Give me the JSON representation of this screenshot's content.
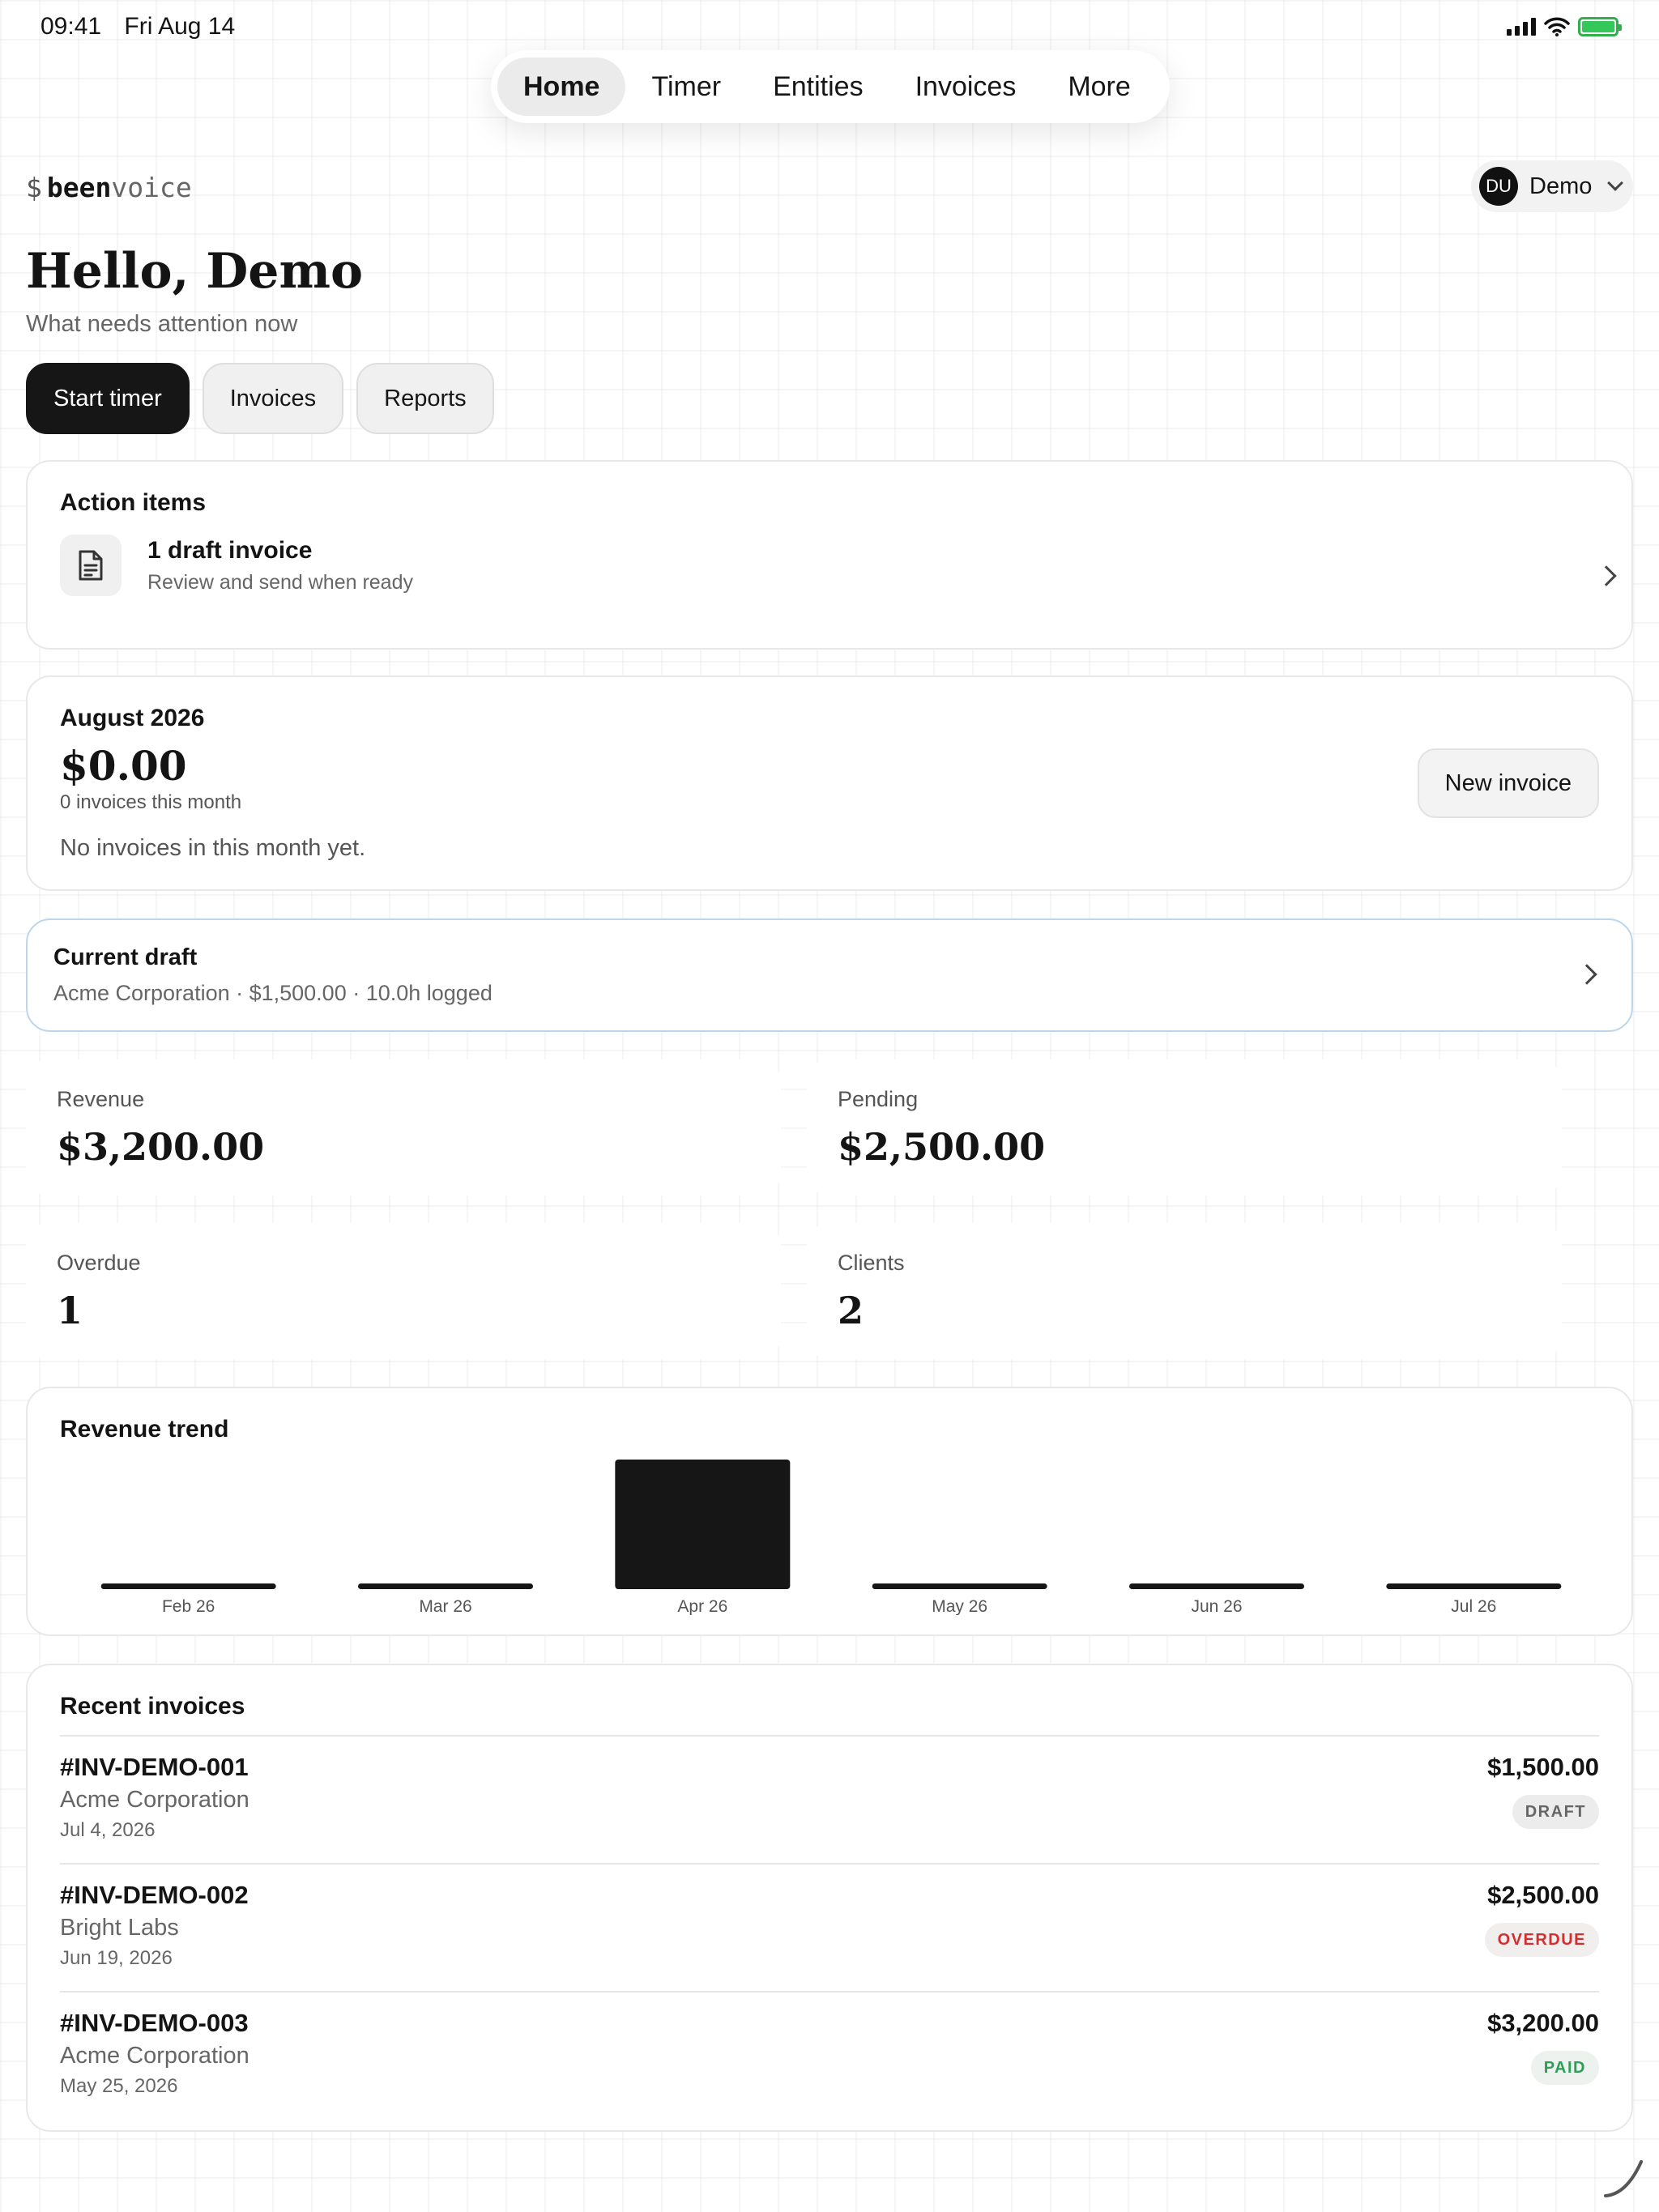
{
  "status_bar": {
    "time": "09:41",
    "date": "Fri Aug 14"
  },
  "nav": {
    "items": [
      {
        "label": "Home",
        "active": true
      },
      {
        "label": "Timer",
        "active": false
      },
      {
        "label": "Entities",
        "active": false
      },
      {
        "label": "Invoices",
        "active": false
      },
      {
        "label": "More",
        "active": false
      }
    ]
  },
  "brand": {
    "symbol": "$",
    "bold": "been",
    "light": "voice"
  },
  "user": {
    "initials": "DU",
    "name": "Demo"
  },
  "greeting": {
    "title": "Hello, Demo",
    "subtitle": "What needs attention now"
  },
  "quick_actions": {
    "start_timer": "Start timer",
    "invoices": "Invoices",
    "reports": "Reports"
  },
  "action_items": {
    "title": "Action items",
    "items": [
      {
        "title": "1 draft invoice",
        "subtitle": "Review and send when ready",
        "icon": "document-icon"
      }
    ]
  },
  "month_summary": {
    "title": "August 2026",
    "amount": "$0.00",
    "count_text": "0 invoices this month",
    "empty_text": "No invoices in this month yet.",
    "new_invoice_label": "New invoice"
  },
  "current_draft": {
    "title": "Current draft",
    "details": "Acme Corporation · $1,500.00 · 10.0h logged"
  },
  "stats": {
    "revenue": {
      "label": "Revenue",
      "value": "$3,200.00"
    },
    "pending": {
      "label": "Pending",
      "value": "$2,500.00"
    },
    "overdue": {
      "label": "Overdue",
      "value": "1"
    },
    "clients": {
      "label": "Clients",
      "value": "2"
    }
  },
  "revenue_trend": {
    "title": "Revenue trend"
  },
  "chart_data": {
    "type": "bar",
    "title": "Revenue trend",
    "categories": [
      "Feb 26",
      "Mar 26",
      "Apr 26",
      "May 26",
      "Jun 26",
      "Jul 26"
    ],
    "values": [
      0,
      0,
      3200,
      0,
      0,
      0
    ],
    "bar_color": "#161616"
  },
  "recent_invoices": {
    "title": "Recent invoices",
    "items": [
      {
        "id": "#INV-DEMO-001",
        "client": "Acme Corporation",
        "date": "Jul 4, 2026",
        "amount": "$1,500.00",
        "status": "DRAFT"
      },
      {
        "id": "#INV-DEMO-002",
        "client": "Bright Labs",
        "date": "Jun 19, 2026",
        "amount": "$2,500.00",
        "status": "OVERDUE"
      },
      {
        "id": "#INV-DEMO-003",
        "client": "Acme Corporation",
        "date": "May 25, 2026",
        "amount": "$3,200.00",
        "status": "PAID"
      }
    ]
  },
  "colors": {
    "accent": "#161616",
    "draft_border": "#bcd6ee",
    "overdue": "#d32f2f",
    "paid": "#2e9d55"
  }
}
